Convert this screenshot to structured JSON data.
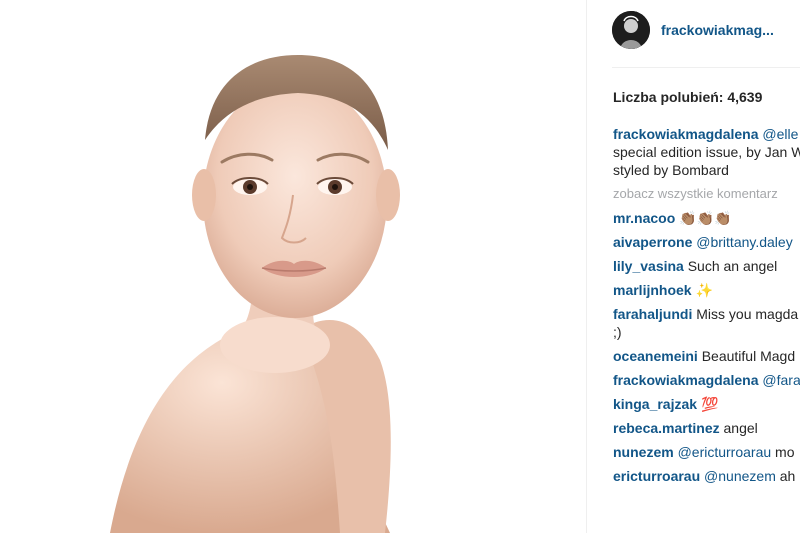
{
  "post": {
    "username": "frackowiakmag...",
    "likes_label": "Liczba polubień: 4,639"
  },
  "caption": {
    "user": "frackowiakmagdalena",
    "mention": "@elle",
    "text": "beauty special edition issue, by Jan Welters and styled by Bombard"
  },
  "view_all_comments": "zobacz wszystkie komentarz",
  "comments": [
    {
      "user": "mr.nacoo",
      "mention": "",
      "text": "👏🏽👏🏽👏🏽"
    },
    {
      "user": "aivaperrone",
      "mention": "@brittany.daley",
      "text": ""
    },
    {
      "user": "lily_vasina",
      "mention": "",
      "text": "Such an angel"
    },
    {
      "user": "marlijnhoek",
      "mention": "",
      "text": "✨"
    },
    {
      "user": "farahaljundi",
      "mention": "",
      "text": "Miss you magda Costa Rica ;)"
    },
    {
      "user": "oceanemeini",
      "mention": "",
      "text": "Beautiful Magd"
    },
    {
      "user": "frackowiakmagdalena",
      "mention": "@fara",
      "text": "🌛"
    },
    {
      "user": "kinga_rajzak",
      "mention": "",
      "text": "💯"
    },
    {
      "user": "rebeca.martinez",
      "mention": "",
      "text": "angel"
    },
    {
      "user": "nunezem",
      "mention": "@ericturroarau",
      "text": "mo"
    },
    {
      "user": "ericturroarau",
      "mention": "@nunezem",
      "text": "ah"
    }
  ],
  "icons": {
    "avatar": "profile-avatar",
    "photo": "portrait-photo"
  }
}
